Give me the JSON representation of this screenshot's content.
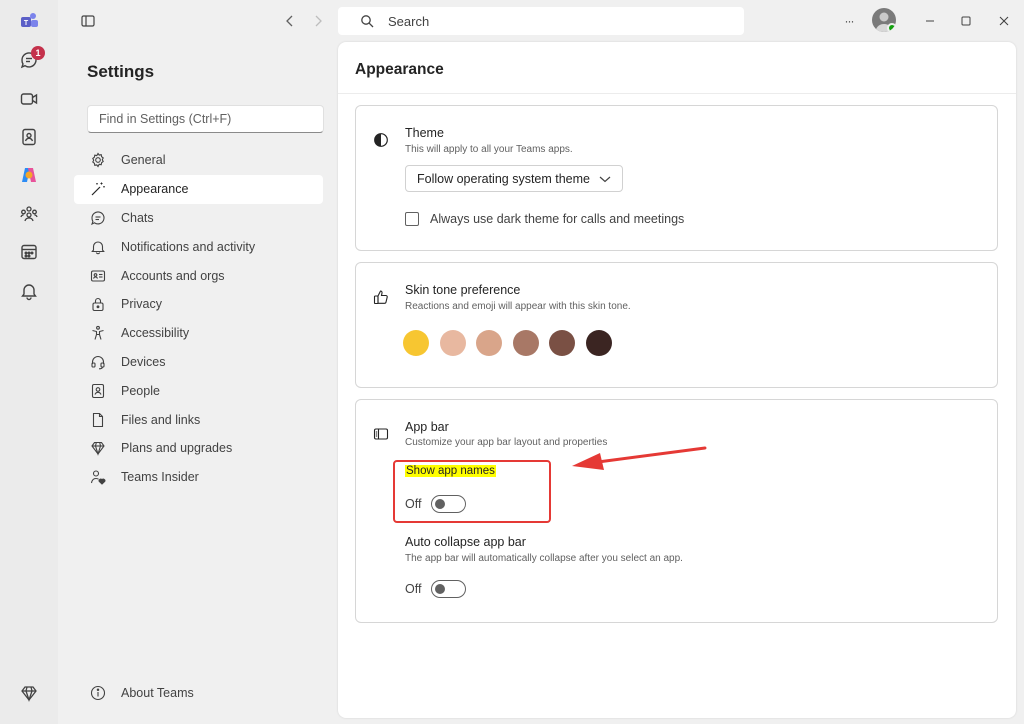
{
  "rail": {
    "chat_badge": "1",
    "items": [
      "teams-logo-icon",
      "chat-icon",
      "video-icon",
      "contacts-icon",
      "copilot-icon",
      "communities-icon",
      "calendar-icon",
      "activity-bell-icon",
      "premium-diamond-icon"
    ]
  },
  "titlebar": {
    "search_placeholder": "Search",
    "more_label": "···"
  },
  "nav": {
    "title": "Settings",
    "find_placeholder": "Find in Settings (Ctrl+F)",
    "items": [
      {
        "label": "General",
        "icon": "gear-icon"
      },
      {
        "label": "Appearance",
        "icon": "magic-wand-icon",
        "active": true
      },
      {
        "label": "Chats",
        "icon": "chat-icon"
      },
      {
        "label": "Notifications and activity",
        "icon": "bell-icon"
      },
      {
        "label": "Accounts and orgs",
        "icon": "id-card-icon"
      },
      {
        "label": "Privacy",
        "icon": "lock-icon"
      },
      {
        "label": "Accessibility",
        "icon": "accessibility-icon"
      },
      {
        "label": "Devices",
        "icon": "headset-icon"
      },
      {
        "label": "People",
        "icon": "person-card-icon"
      },
      {
        "label": "Files and links",
        "icon": "document-icon"
      },
      {
        "label": "Plans and upgrades",
        "icon": "diamond-icon"
      },
      {
        "label": "Teams Insider",
        "icon": "person-heart-icon"
      }
    ],
    "about": "About Teams"
  },
  "main": {
    "title": "Appearance",
    "theme": {
      "title": "Theme",
      "subtitle": "This will apply to all your Teams apps.",
      "dropdown_value": "Follow operating system theme",
      "checkbox_label": "Always use dark theme for calls and meetings"
    },
    "skin_tone": {
      "title": "Skin tone preference",
      "subtitle": "Reactions and emoji will appear with this skin tone.",
      "tones": [
        "#f7c631",
        "#e8b8a0",
        "#d9a58a",
        "#a87866",
        "#7a5044",
        "#3b2522"
      ]
    },
    "app_bar": {
      "title": "App bar",
      "subtitle": "Customize your app bar layout and properties",
      "show_names_label": "Show app names",
      "show_names_state": "Off",
      "auto_collapse_label": "Auto collapse app bar",
      "auto_collapse_subtitle": "The app bar will automatically collapse after you select an app.",
      "auto_collapse_state": "Off"
    }
  },
  "colors": {
    "accent": "#5b5fc7",
    "annotation_red": "#e53935",
    "highlight": "#ffff00"
  }
}
